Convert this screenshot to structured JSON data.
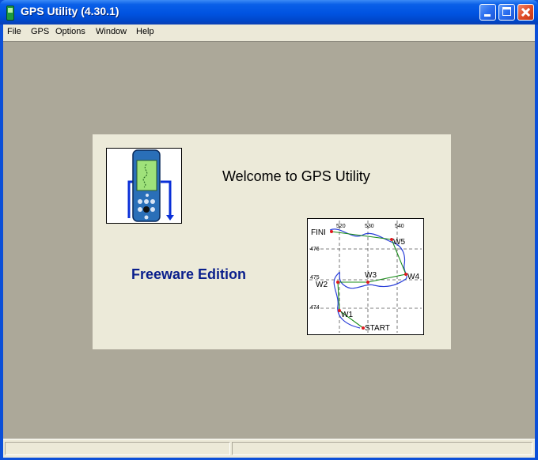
{
  "window": {
    "title": "GPS Utility (4.30.1)"
  },
  "menu": {
    "items": [
      "File",
      "GPS",
      "Options",
      "Window",
      "Help"
    ]
  },
  "splash": {
    "welcome": "Welcome to GPS Utility",
    "edition": "Freeware Edition",
    "map": {
      "x_ticks": [
        "520",
        "530",
        "540"
      ],
      "y_ticks": [
        "476",
        "475",
        "474"
      ],
      "waypoints": [
        "FINI",
        "W5",
        "W4",
        "W3",
        "W2",
        "W1",
        "START"
      ]
    }
  },
  "colors": {
    "title_bar": "#0054e3",
    "mdi_background": "#aca899",
    "edition_text": "#0a1f8c",
    "route": "#1a8c1a",
    "track": "#2a3fd8",
    "waypoint": "#e0191e"
  }
}
